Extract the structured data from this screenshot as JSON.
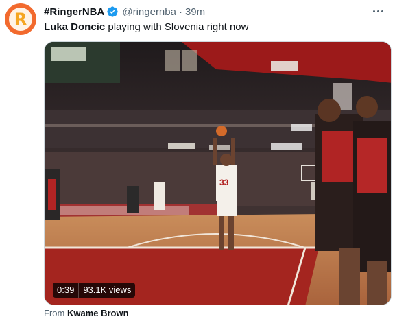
{
  "tweet": {
    "display_name": "#RingerNBA",
    "handle": "@ringernba",
    "separator": "·",
    "time": "39m",
    "text_bold": "Luka Doncic",
    "text_rest": " playing with Slovenia right now",
    "avatar_letter": "R",
    "avatar_colors": {
      "outer": "#f26a2e",
      "inner": "#fff3e6",
      "letter": "#f5a623"
    },
    "verified_icon": "verified-badge-icon",
    "verified_color": "#1d9bf0"
  },
  "video": {
    "duration": "0:39",
    "views": "93.1K views",
    "jersey_number": "33"
  },
  "attribution": {
    "prefix": "From ",
    "source": "Kwame Brown"
  }
}
